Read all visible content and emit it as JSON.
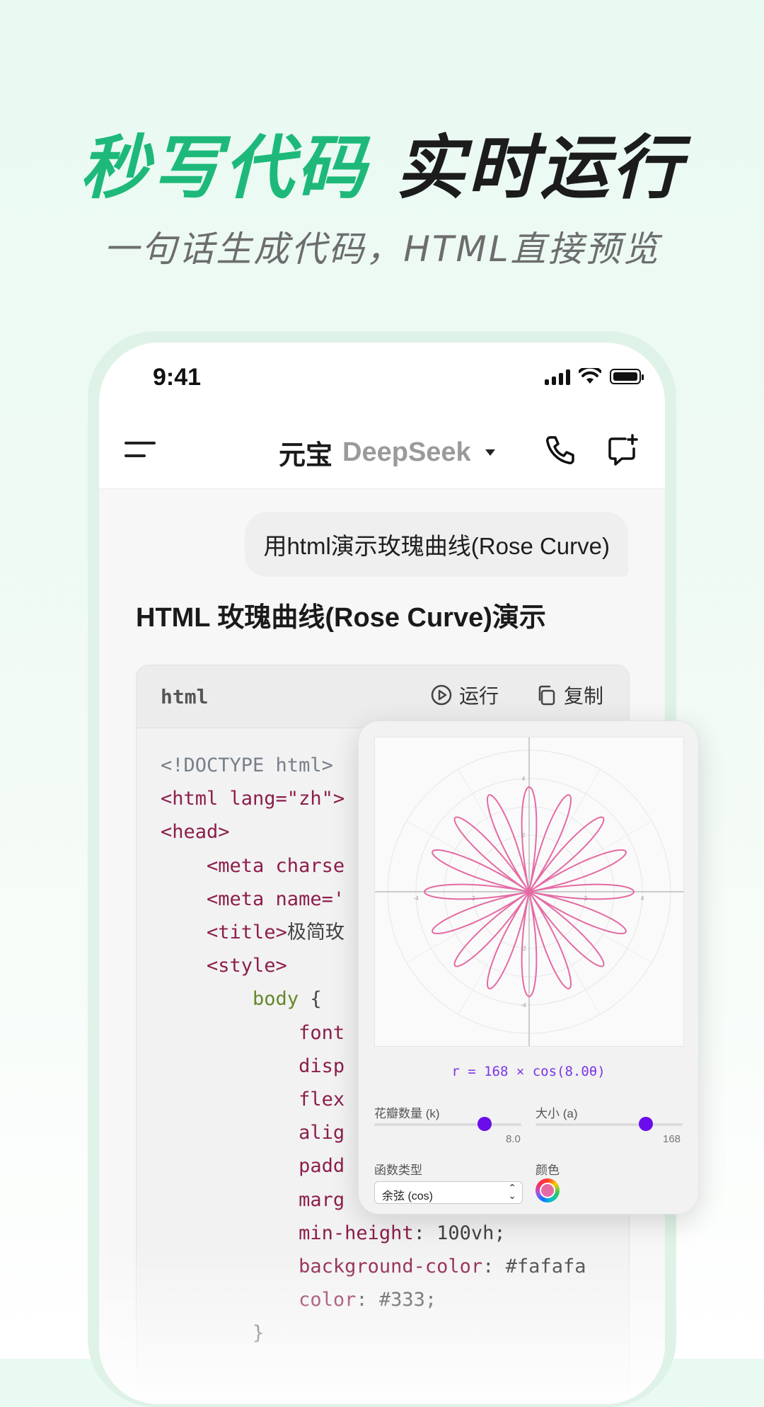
{
  "hero": {
    "title_green": "秒写代码",
    "title_dark": "实时运行",
    "subtitle": "一句话生成代码，HTML直接预览"
  },
  "status": {
    "time": "9:41"
  },
  "header": {
    "title": "元宝",
    "model": "DeepSeek"
  },
  "chat": {
    "user_message": "用html演示玫瑰曲线(Rose Curve)",
    "answer_title": "HTML 玫瑰曲线(Rose Curve)演示"
  },
  "code_block": {
    "language": "html",
    "run_label": "运行",
    "copy_label": "复制",
    "lines": [
      "<!DOCTYPE html>",
      "<html lang=\"zh\">",
      "<head>",
      "    <meta charse",
      "    <meta name='",
      "    <title>极简玫",
      "    <style>",
      "        body {",
      "            font",
      "            disp",
      "            flex",
      "            alig",
      "            padd",
      "            marg",
      "            min-height: 100vh;",
      "            background-color: #fafafa",
      "            color: #333;",
      "        }"
    ]
  },
  "preview": {
    "formula": "r = 168 × cos(8.0θ)",
    "petals_label": "花瓣数量 (k)",
    "petals_value": "8.0",
    "petals_fraction": 0.75,
    "size_label": "大小 (a)",
    "size_value": "168",
    "size_fraction": 0.75,
    "function_label": "函数类型",
    "function_selected": "余弦 (cos)",
    "color_label": "颜色",
    "curve_color": "#e56aa4",
    "accent_color": "#6a0dea",
    "axis_ticks": [
      "-4",
      "-2",
      "2",
      "4"
    ],
    "k": 8,
    "a": 168
  }
}
